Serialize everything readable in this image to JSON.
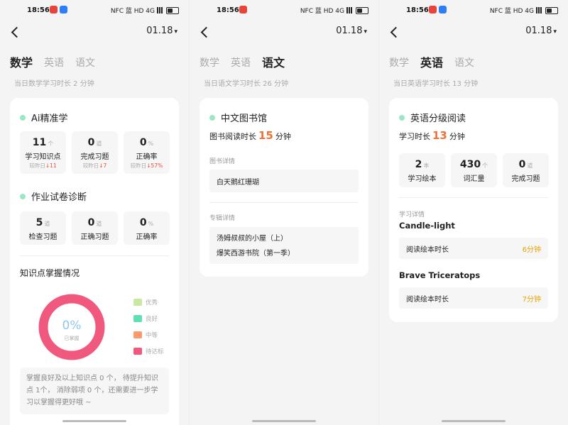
{
  "status": {
    "time": "18:56",
    "right_text": "NFC 蓝 HD 4G"
  },
  "date": "01.18",
  "date_caret": "▾",
  "screens": [
    {
      "tabs": [
        "数学",
        "英语",
        "语文"
      ],
      "active_tab": 0,
      "subinfo": "当日数学学习时长 2 分钟",
      "ai": {
        "title": "Ai精准学",
        "stats": [
          {
            "num": "11",
            "unit": "个",
            "label": "学习知识点",
            "compare": "较昨日",
            "delta": "↓11"
          },
          {
            "num": "0",
            "unit": "道",
            "label": "完成习题",
            "compare": "较昨日",
            "delta": "↓7"
          },
          {
            "num": "0",
            "unit": "%",
            "label": "正确率",
            "compare": "较昨日",
            "delta": "↓57%"
          }
        ]
      },
      "homework": {
        "title": "作业试卷诊断",
        "stats": [
          {
            "num": "5",
            "unit": "道",
            "label": "检查习题"
          },
          {
            "num": "0",
            "unit": "道",
            "label": "正确习题"
          },
          {
            "num": "0",
            "unit": "%",
            "label": "正确率"
          }
        ]
      },
      "mastery": {
        "title": "知识点掌握情况",
        "percent": "0%",
        "center_label": "已掌握",
        "legend": [
          {
            "label": "优秀",
            "color": "#c9e8a0"
          },
          {
            "label": "良好",
            "color": "#5fe0b0"
          },
          {
            "label": "中等",
            "color": "#f79a6e"
          },
          {
            "label": "待达标",
            "color": "#f0587e"
          }
        ],
        "ring_color": "#f0587e",
        "percent_color": "#8fc7f2",
        "note": "掌握良好及以上知识点 0 个， 待提升知识点 1个， 消除弱项 0 个，还需要进一步学习以掌握得更好哦 ~"
      }
    },
    {
      "tabs": [
        "数学",
        "英语",
        "语文"
      ],
      "active_tab": 2,
      "subinfo": "当日语文学习时长 26 分钟",
      "library": {
        "title": "中文图书馆",
        "reading_prefix": "图书阅读时长",
        "reading_value": "15",
        "reading_unit": "分钟",
        "book_label": "图书详情",
        "books": [
          "白天鹅红珊瑚"
        ],
        "album_label": "专辑详情",
        "albums": [
          "汤姆叔叔的小屋（上）",
          "爆笑西游书院（第一季）"
        ]
      }
    },
    {
      "tabs": [
        "数学",
        "英语",
        "语文"
      ],
      "active_tab": 1,
      "subinfo": "当日英语学习时长 13 分钟",
      "graded": {
        "title": "英语分级阅读",
        "time_prefix": "学习时长",
        "time_value": "13",
        "time_unit": "分钟",
        "stats": [
          {
            "num": "2",
            "unit": "本",
            "label": "学习绘本"
          },
          {
            "num": "430",
            "unit": "个",
            "label": "词汇量"
          },
          {
            "num": "0",
            "unit": "道",
            "label": "完成习题"
          }
        ],
        "detail_label": "学习详情",
        "books": [
          {
            "name": "Candle-light",
            "row_label": "阅读绘本时长",
            "minutes": "6分钟"
          },
          {
            "name": "Brave Triceratops",
            "row_label": "阅读绘本时长",
            "minutes": "7分钟"
          }
        ]
      }
    }
  ]
}
